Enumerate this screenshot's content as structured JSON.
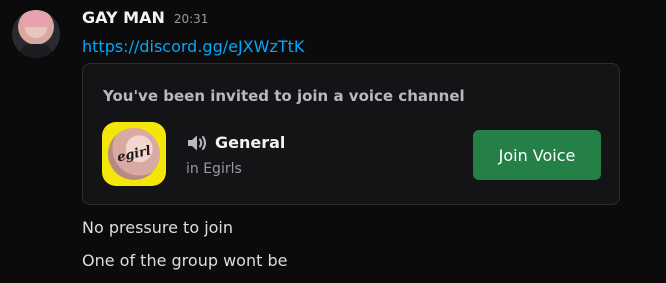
{
  "message": {
    "username": "GAY MAN",
    "timestamp": "20:31",
    "link": "https://discord.gg/eJXWzTtK",
    "lines": [
      "No pressure to join",
      "One of the group wont be"
    ]
  },
  "invite": {
    "heading": "You've been invited to join a voice channel",
    "server_icon_text": "egirl",
    "channel_name": "General",
    "server_name": "in Egirls",
    "join_label": "Join Voice"
  },
  "colors": {
    "link": "#00a8fc",
    "join_button": "#248046",
    "server_icon_bg": "#f5e60a"
  },
  "icons": {
    "channel": "speaker-icon"
  }
}
